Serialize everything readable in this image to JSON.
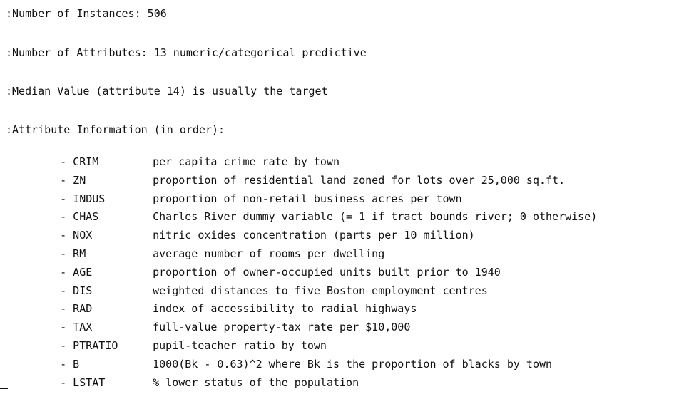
{
  "header_lines": {
    "instances": ":Number of Instances: 506",
    "attributes": ":Number of Attributes: 13 numeric/categorical predictive",
    "median": ":Median Value (attribute 14) is usually the target",
    "info_heading": ":Attribute Information (in order):"
  },
  "attributes": [
    {
      "name": "- CRIM",
      "desc": "per capita crime rate by town"
    },
    {
      "name": "- ZN",
      "desc": "proportion of residential land zoned for lots over 25,000 sq.ft."
    },
    {
      "name": "- INDUS",
      "desc": "proportion of non-retail business acres per town"
    },
    {
      "name": "- CHAS",
      "desc": "Charles River dummy variable (= 1 if tract bounds river; 0 otherwise)"
    },
    {
      "name": "- NOX",
      "desc": "nitric oxides concentration (parts per 10 million)"
    },
    {
      "name": "- RM",
      "desc": "average number of rooms per dwelling"
    },
    {
      "name": "- AGE",
      "desc": "proportion of owner-occupied units built prior to 1940"
    },
    {
      "name": "- DIS",
      "desc": "weighted distances to five Boston employment centres"
    },
    {
      "name": "- RAD",
      "desc": "index of accessibility to radial highways"
    },
    {
      "name": "- TAX",
      "desc": "full-value property-tax rate per $10,000"
    },
    {
      "name": "- PTRATIO",
      "desc": "pupil-teacher ratio by town"
    },
    {
      "name": "- B",
      "desc": "1000(Bk - 0.63)^2 where Bk is the proportion of blacks by town"
    },
    {
      "name": "- LSTAT",
      "desc": "% lower status of the population"
    }
  ]
}
